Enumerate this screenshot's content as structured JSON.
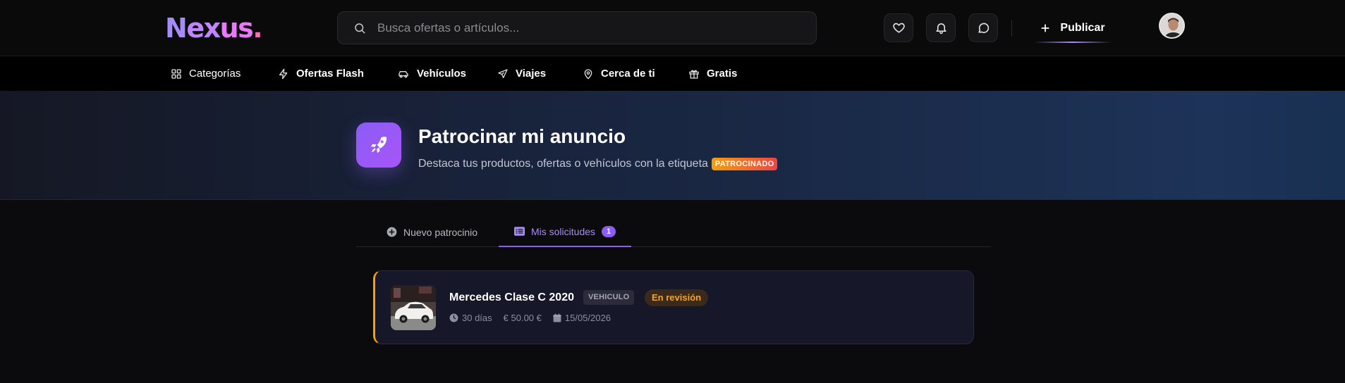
{
  "header": {
    "logo": {
      "part1": "N",
      "part2": "ex",
      "part3": "us",
      "dot": "."
    },
    "search": {
      "placeholder": "Busca ofertas o artículos..."
    },
    "publish_label": "Publicar"
  },
  "nav": {
    "items": [
      {
        "label": "Categorías",
        "icon": "grid-icon"
      },
      {
        "label": "Ofertas Flash",
        "icon": "lightning-icon"
      },
      {
        "label": "Vehículos",
        "icon": "car-icon"
      },
      {
        "label": "Viajes",
        "icon": "plane-icon"
      },
      {
        "label": "Cerca de ti",
        "icon": "map-pin-icon"
      },
      {
        "label": "Gratis",
        "icon": "gift-icon"
      }
    ]
  },
  "hero": {
    "title": "Patrocinar mi anuncio",
    "subtitle": "Destaca tus productos, ofertas o vehículos con la etiqueta",
    "badge": "PATROCINADO",
    "icon": "rocket-icon"
  },
  "tabs": [
    {
      "label": "Nuevo patrocinio",
      "icon": "plus-circle-icon",
      "active": false
    },
    {
      "label": "Mis solicitudes",
      "icon": "list-icon",
      "active": true,
      "count": "1"
    }
  ],
  "requests": [
    {
      "title": "Mercedes Clase C 2020",
      "type": "VEHICULO",
      "status": "En revisión",
      "duration": "30 días",
      "price": "€ 50.00 €",
      "date": "15/05/2026"
    }
  ],
  "colors": {
    "accent": "#8b5cf6",
    "status_review": "#f5a524",
    "background": "#0b0b0d"
  }
}
